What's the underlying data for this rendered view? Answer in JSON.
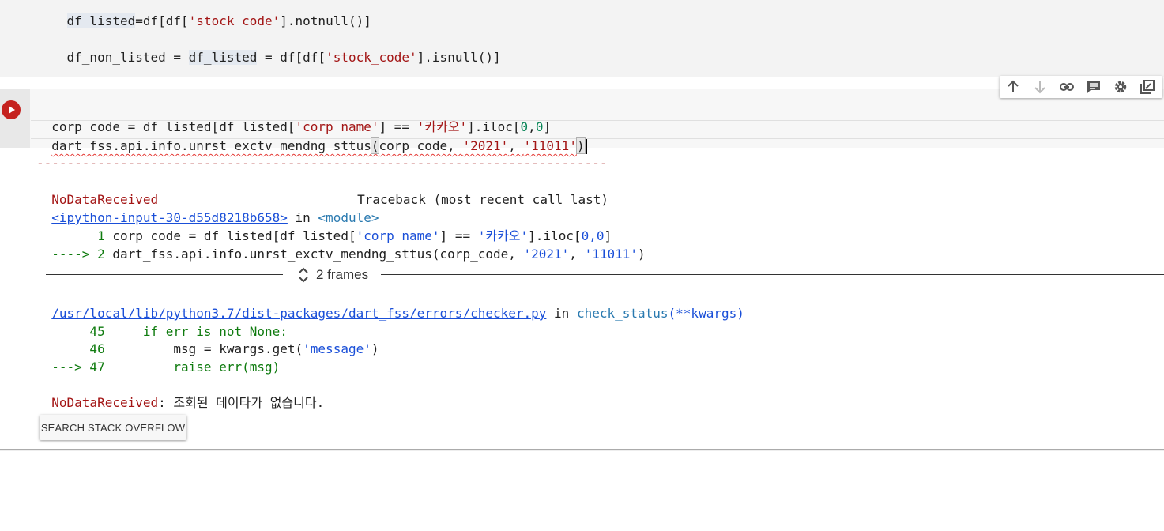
{
  "prev_cell": {
    "line1": {
      "a": "df_listed",
      "b": "=df[df[",
      "c": "'stock_code'",
      "d": "].notnull()]"
    },
    "line2": {
      "a": "df_non_listed = ",
      "b": "df_listed",
      "c": " = df[df[",
      "d": "'stock_code'",
      "e": "].isnull()]"
    }
  },
  "toolbar": {
    "icons": [
      "arrow-up-icon",
      "arrow-down-icon",
      "link-icon",
      "comment-icon",
      "gear-icon",
      "mirror-cell-icon"
    ]
  },
  "code_cell": {
    "line1": {
      "a": "corp_code = df_listed[df_listed[",
      "b": "'corp_name'",
      "c": "] == ",
      "d": "'카카오'",
      "e": "].iloc[",
      "f": "0",
      "g": ",",
      "h": "0",
      "i": "]"
    },
    "line2": {
      "a": "dart_fss.api.info.unrst_exctv_mendng_sttus",
      "b": "(",
      "c": "corp_code, ",
      "d": "'2021'",
      "e": ", ",
      "f": "'11011'",
      "g": ")"
    }
  },
  "output": {
    "dashes": "---------------------------------------------------------------------------",
    "err_name": "NoDataReceived",
    "traceback_label": "Traceback (most recent call last)",
    "input_link": "<ipython-input-30-d55d8218b658>",
    "in_word": " in ",
    "module": "<module>",
    "tb1": {
      "num": "      1 ",
      "a": "corp_code = df_listed[df_listed[",
      "b": "'corp_name'",
      "c": "] == ",
      "d": "'카카오'",
      "e": "].iloc[",
      "f": "0,0",
      "g": "]"
    },
    "tb2": {
      "arrow": "----> 2 ",
      "a": "dart_fss.api.info.unrst_exctv_mendng_sttus(corp_code, ",
      "b": "'2021'",
      "c": ", ",
      "d": "'11011'",
      "e": ")"
    },
    "frames_label": "2 frames",
    "file_link": "/usr/local/lib/python3.7/dist-packages/dart_fss/errors/checker.py",
    "func": "check_status",
    "func_args": "(**kwargs)",
    "l45": {
      "num": "     45 ",
      "a": "    if err is not None:"
    },
    "l46": {
      "num": "     46 ",
      "a": "        msg = kwargs.get(",
      "b": "'message'",
      "c": ")"
    },
    "l47": {
      "arrow": "---> 47 ",
      "a": "        raise err(msg)"
    },
    "final_err": "NoDataReceived",
    "final_msg": ": 조회된 데이타가 없습니다."
  },
  "search_button": "SEARCH STACK OVERFLOW"
}
